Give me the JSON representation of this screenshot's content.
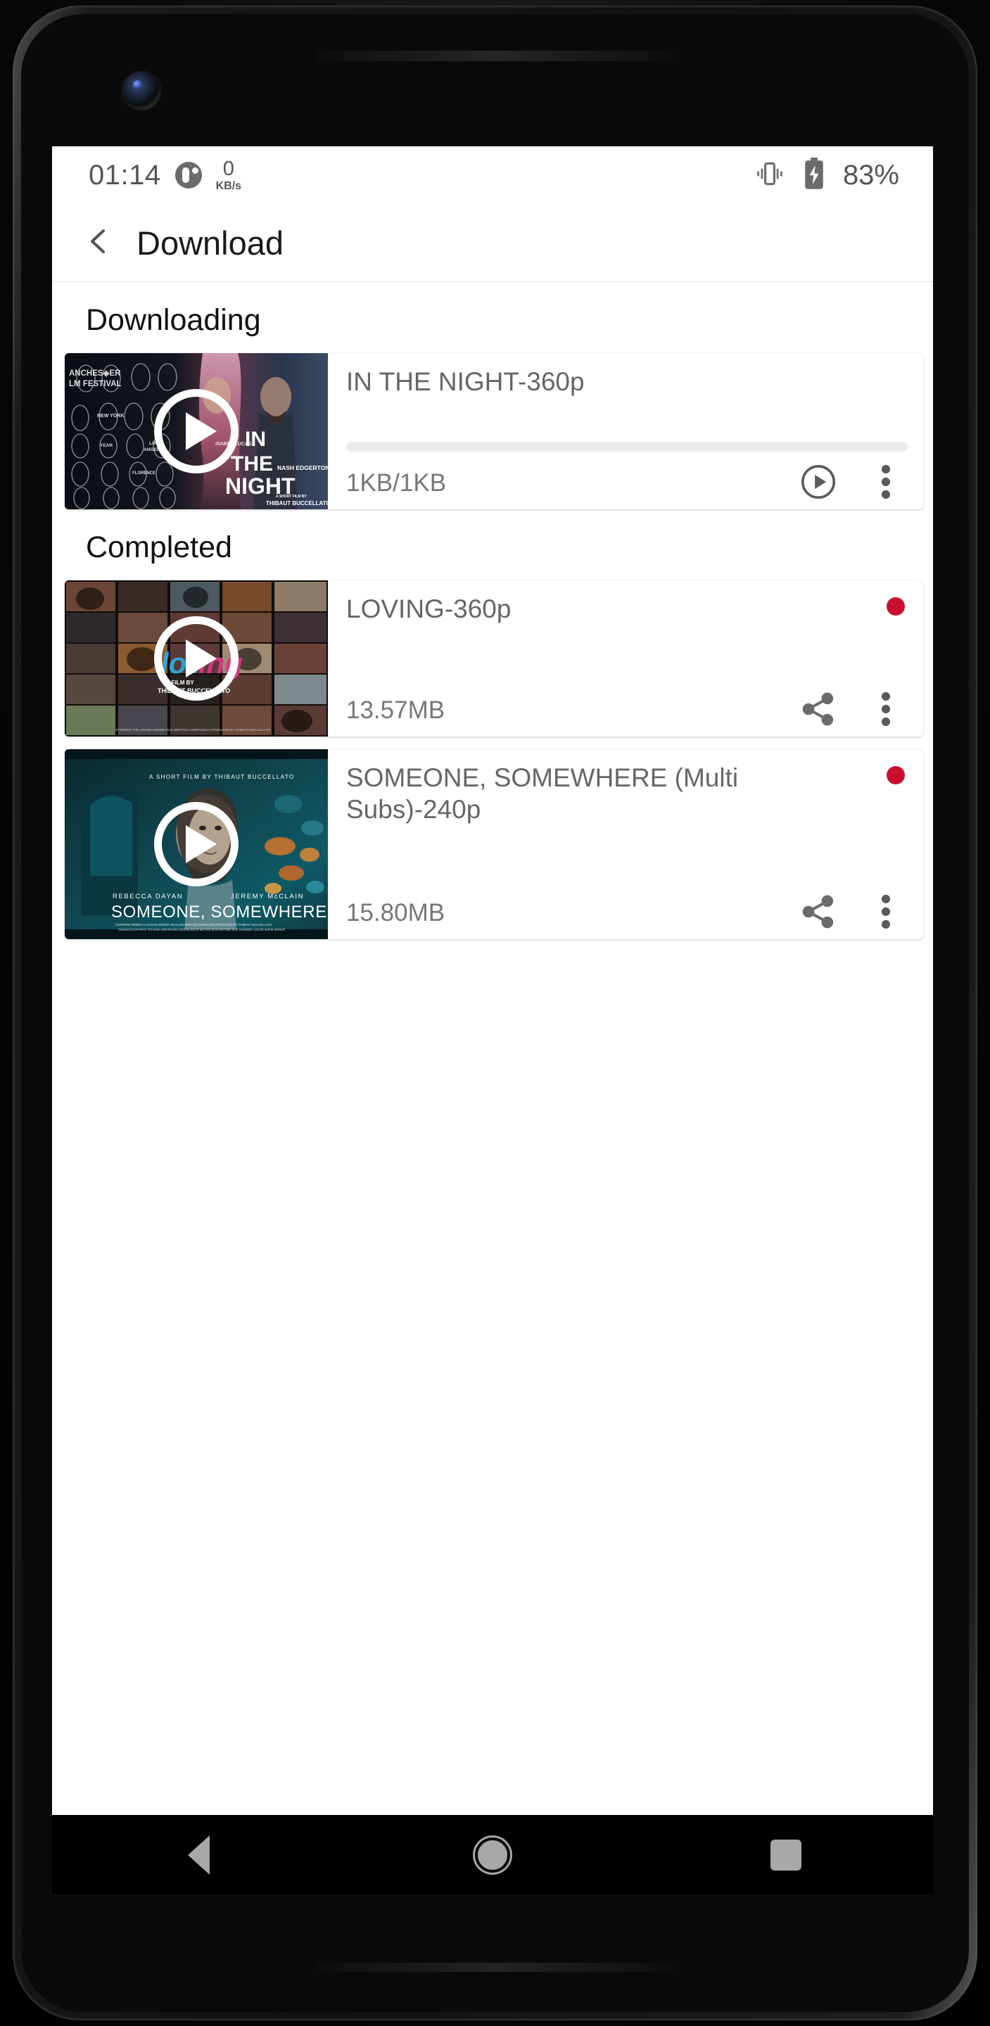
{
  "status_bar": {
    "time": "01:14",
    "network_speed_value": "0",
    "network_speed_unit": "KB/s",
    "battery_percent": "83%",
    "vibrate_icon": "vibrate-icon",
    "battery_icon": "battery-charging-icon",
    "data_saver_icon": "data-indicator-icon"
  },
  "app_bar": {
    "back_icon": "back-chevron-icon",
    "title": "Download"
  },
  "sections": [
    {
      "id": "downloading",
      "label": "Downloading"
    },
    {
      "id": "completed",
      "label": "Completed"
    }
  ],
  "downloading_items": [
    {
      "title": "IN THE NIGHT-360p",
      "size": "1KB/1KB",
      "progress_percent": 0,
      "thumbnail": "in-the-night-poster",
      "play_icon": "play-circle-icon",
      "menu_icon": "overflow-menu-icon",
      "has_badge": false
    }
  ],
  "completed_items": [
    {
      "title": "LOVING-360p",
      "size": "13.57MB",
      "thumbnail": "loving-collage-poster",
      "share_icon": "share-icon",
      "menu_icon": "overflow-menu-icon",
      "has_badge": true,
      "badge_color": "#C8102E"
    },
    {
      "title": "SOMEONE, SOMEWHERE (Multi Subs)-240p",
      "size": "15.80MB",
      "thumbnail": "someone-somewhere-poster",
      "share_icon": "share-icon",
      "menu_icon": "overflow-menu-icon",
      "has_badge": true,
      "badge_color": "#C8102E"
    }
  ],
  "nav_bar": {
    "back": "nav-back-icon",
    "home": "nav-home-icon",
    "recents": "nav-recents-icon"
  },
  "colors": {
    "accent_red": "#C8102E",
    "title_text": "#1a1a1a",
    "body_text": "#666666",
    "icon_gray": "#6b6b6b",
    "track_gray": "#ececec"
  }
}
